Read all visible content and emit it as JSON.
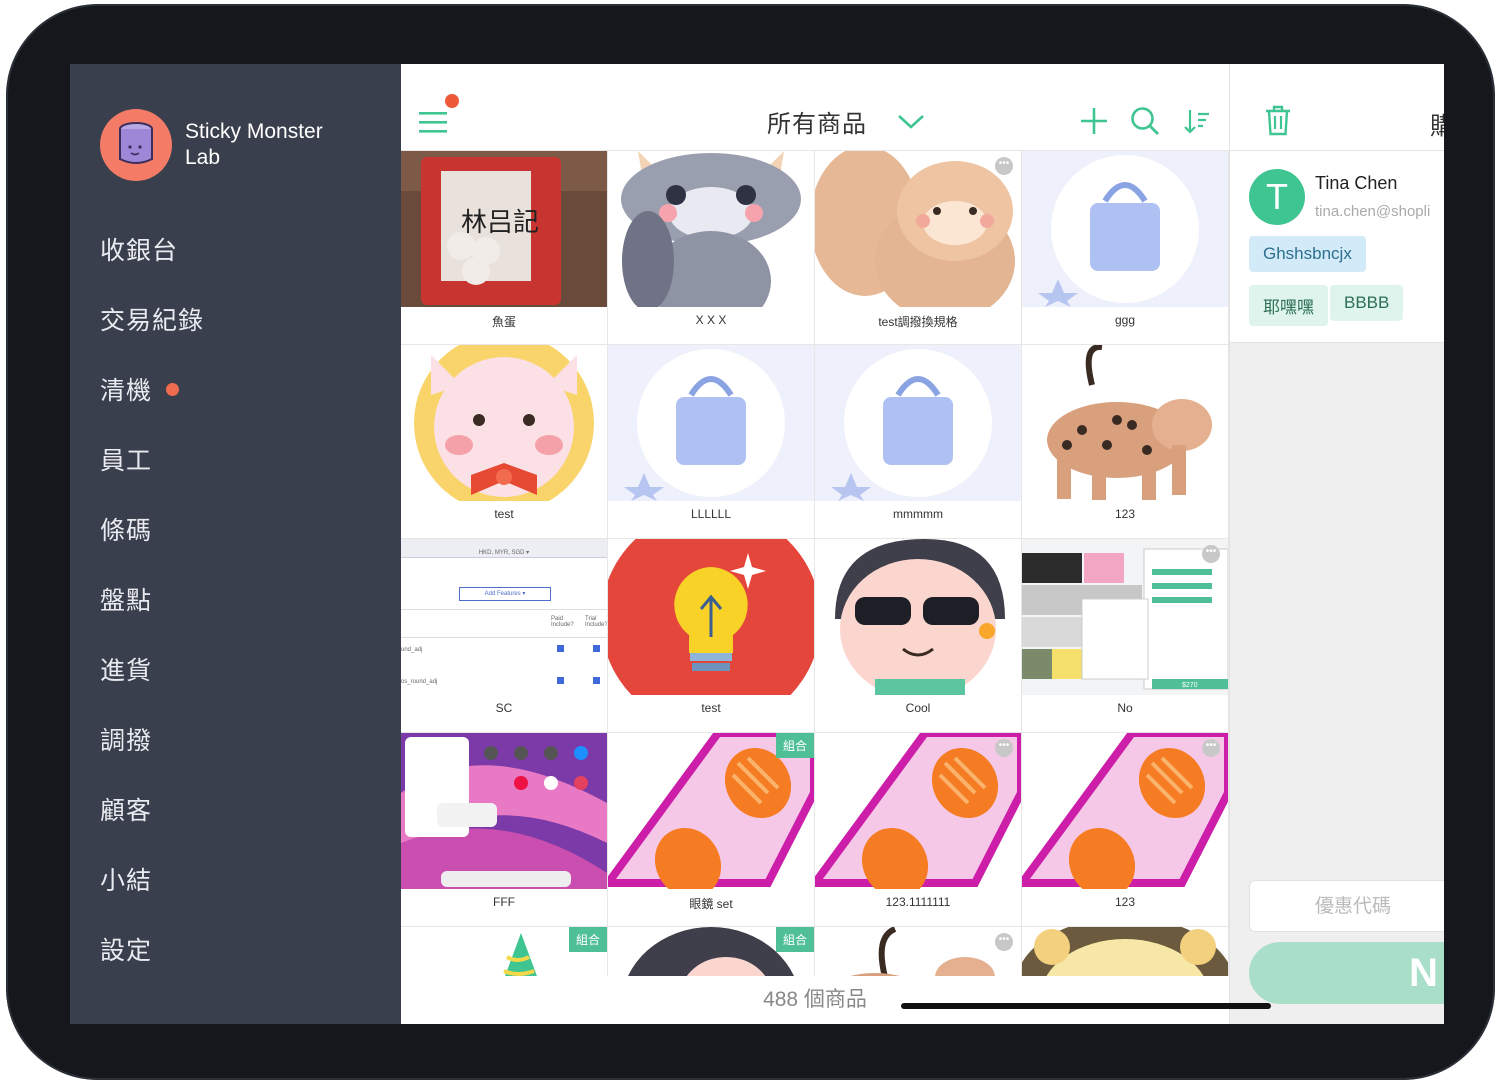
{
  "brand": {
    "name": "Sticky Monster Lab"
  },
  "nav": [
    {
      "label": "收銀台",
      "badge": false
    },
    {
      "label": "交易紀錄",
      "badge": false
    },
    {
      "label": "清機",
      "badge": true
    },
    {
      "label": "員工",
      "badge": false
    },
    {
      "label": "條碼",
      "badge": false
    },
    {
      "label": "盤點",
      "badge": false
    },
    {
      "label": "進貨",
      "badge": false
    },
    {
      "label": "調撥",
      "badge": false
    },
    {
      "label": "顧客",
      "badge": false
    },
    {
      "label": "小結",
      "badge": false
    },
    {
      "label": "設定",
      "badge": false
    }
  ],
  "toolbar": {
    "title": "所有商品",
    "icons": [
      "menu-icon",
      "chevron-down-icon",
      "plus-icon",
      "search-icon",
      "sort-icon"
    ]
  },
  "products": [
    {
      "name": "魚蛋",
      "combo": false,
      "more": false
    },
    {
      "name": "X X X",
      "combo": false,
      "more": false
    },
    {
      "name": "test調撥換規格",
      "combo": false,
      "more": true
    },
    {
      "name": "ggg",
      "combo": false,
      "more": false
    },
    {
      "name": "test",
      "combo": false,
      "more": false
    },
    {
      "name": "LLLLLL",
      "combo": false,
      "more": false
    },
    {
      "name": "mmmmm",
      "combo": false,
      "more": false
    },
    {
      "name": "123",
      "combo": false,
      "more": false
    },
    {
      "name": "SC",
      "combo": false,
      "more": false
    },
    {
      "name": "test",
      "combo": false,
      "more": false
    },
    {
      "name": "Cool",
      "combo": false,
      "more": false
    },
    {
      "name": "No",
      "combo": false,
      "more": true
    },
    {
      "name": "FFF",
      "combo": false,
      "more": false
    },
    {
      "name": "眼鏡 set",
      "combo": true,
      "more": false
    },
    {
      "name": "123.1111111",
      "combo": false,
      "more": true
    },
    {
      "name": "123",
      "combo": false,
      "more": true
    },
    {
      "name": "",
      "combo": true,
      "more": false
    },
    {
      "name": "",
      "combo": true,
      "more": false
    },
    {
      "name": "",
      "combo": false,
      "more": true
    },
    {
      "name": "",
      "combo": false,
      "more": false
    }
  ],
  "combo_label": "組合",
  "screenshot_texts": {
    "sc_top": "HKD, MYR, SGD ▾",
    "sc_btn": "Add Features ▾",
    "sc_col1": "Paid Include?",
    "sc_col2": "Trial Include?",
    "sc_row1": "und_adj",
    "sc_row2": "os_round_adj",
    "no_price": "$270"
  },
  "product_count": "488 個商品",
  "cart": {
    "header_partial": "購",
    "customer": {
      "initial": "T",
      "name": "Tina Chen",
      "email": "tina.chen@shopli"
    },
    "tags": [
      "Ghshsbncjx",
      "耶嘿嘿",
      "BBBB"
    ],
    "coupon_placeholder": "優惠代碼",
    "checkout_partial": "N"
  },
  "colors": {
    "sidebar": "#3a3f4d",
    "accent": "#3fc591",
    "badge": "#ee6b4f",
    "combo": "#4fbf97"
  }
}
